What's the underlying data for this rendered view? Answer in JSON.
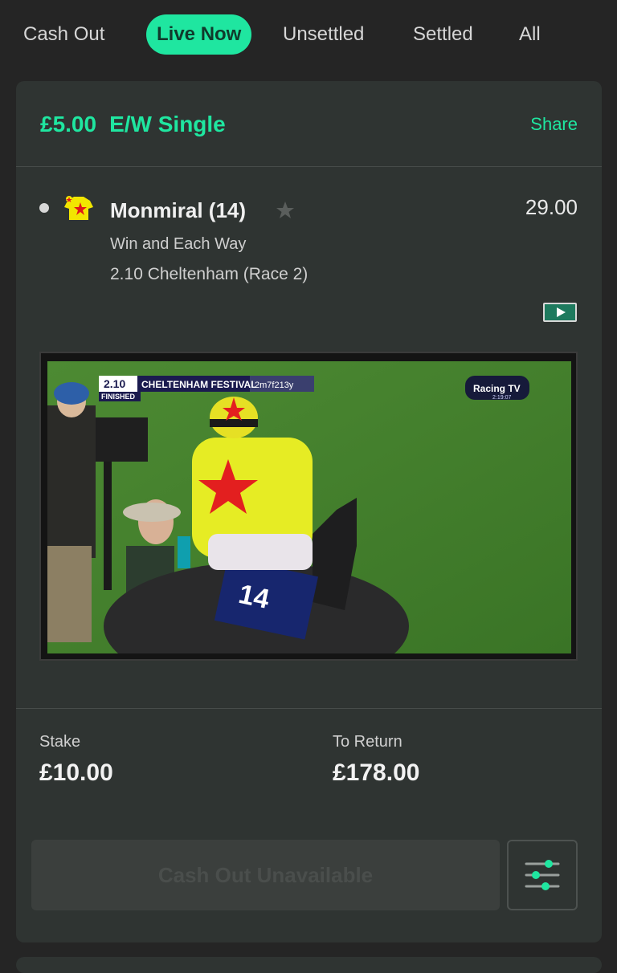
{
  "tabs": [
    {
      "label": "Cash Out",
      "active": false
    },
    {
      "label": "Live Now",
      "active": true
    },
    {
      "label": "Unsettled",
      "active": false
    },
    {
      "label": "Settled",
      "active": false
    },
    {
      "label": "All",
      "active": false
    }
  ],
  "bet": {
    "stake_amount": "£5.00",
    "bet_type": "E/W Single",
    "share_label": "Share",
    "selection": {
      "horse": "Monmiral (14)",
      "odds": "29.00",
      "market": "Win and Each Way",
      "race": "2.10 Cheltenham (Race 2)"
    },
    "video": {
      "race_time": "2.10",
      "festival": "CHELTENHAM FESTIVAL",
      "distance": "2m7f213y",
      "status": "FINISHED",
      "channel": "Racing TV",
      "channel_time": "2:19:07",
      "saddlecloth_number": "14"
    },
    "summary": {
      "stake_label": "Stake",
      "stake_value": "£10.00",
      "return_label": "To Return",
      "return_value": "£178.00"
    },
    "cashout_label": "Cash Out Unavailable"
  },
  "colors": {
    "accent": "#1fe6a0",
    "background": "#252525",
    "card": "#2f3432"
  },
  "icons": [
    "silks-icon",
    "favourite-star-icon",
    "play-icon",
    "settings-sliders-icon"
  ]
}
